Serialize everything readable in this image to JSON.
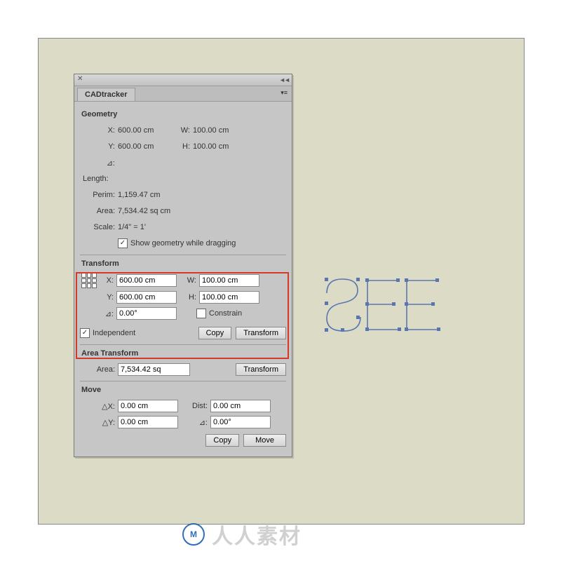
{
  "panel": {
    "title": "CADtracker"
  },
  "geometry": {
    "header": "Geometry",
    "x_lbl": "X:",
    "x": "600.00 cm",
    "y_lbl": "Y:",
    "y": "600.00 cm",
    "w_lbl": "W:",
    "w": "100.00 cm",
    "h_lbl": "H:",
    "h": "100.00 cm",
    "angle_lbl": "⊿:",
    "length_lbl": "Length:",
    "perim_lbl": "Perim:",
    "perim": "1,159.47 cm",
    "area_lbl": "Area:",
    "area": "7,534.42 sq cm",
    "scale_lbl": "Scale:",
    "scale": "1/4\" = 1'",
    "show_drag": "Show geometry while dragging"
  },
  "transform": {
    "header": "Transform",
    "x_lbl": "X:",
    "x": "600.00 cm",
    "y_lbl": "Y:",
    "y": "600.00 cm",
    "w_lbl": "W:",
    "w": "100.00 cm",
    "h_lbl": "H:",
    "h": "100.00 cm",
    "angle_lbl": "⊿:",
    "angle": "0.00°",
    "constrain": "Constrain",
    "independent": "Independent",
    "copy_btn": "Copy",
    "transform_btn": "Transform"
  },
  "area_transform": {
    "header": "Area Transform",
    "area_lbl": "Area:",
    "area": "7,534.42 sq",
    "transform_btn": "Transform"
  },
  "move": {
    "header": "Move",
    "dx_lbl": "△X:",
    "dx": "0.00 cm",
    "dy_lbl": "△Y:",
    "dy": "0.00 cm",
    "dist_lbl": "Dist:",
    "dist": "0.00 cm",
    "angle_lbl": "⊿:",
    "angle": "0.00°",
    "copy_btn": "Copy",
    "move_btn": "Move"
  },
  "watermark": {
    "logo": "M",
    "text": "人人素材"
  }
}
